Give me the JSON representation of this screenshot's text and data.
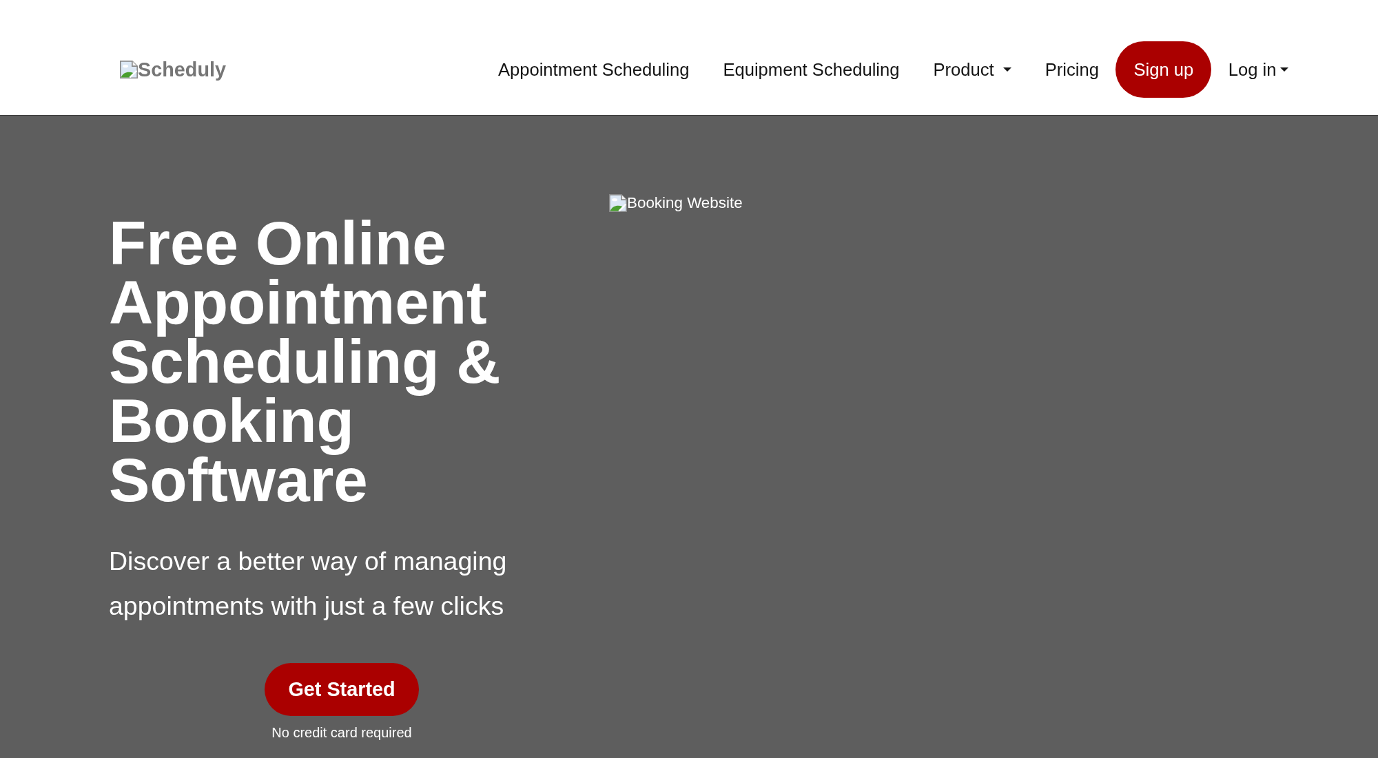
{
  "header": {
    "logo": {
      "alt_text": "Scheduly"
    },
    "nav": [
      {
        "label": "Appointment Scheduling",
        "kind": "link"
      },
      {
        "label": "Equipment Scheduling",
        "kind": "link"
      },
      {
        "label": "Product",
        "kind": "dropdown"
      },
      {
        "label": "Pricing",
        "kind": "link"
      },
      {
        "label": "Sign up",
        "kind": "button"
      },
      {
        "label": "Log in",
        "kind": "menu"
      }
    ]
  },
  "hero": {
    "heading": "Free Online Appointment Scheduling & Booking Software",
    "subheading": "Discover a better way of managing appointments with just a few clicks",
    "cta": {
      "label": "Get Started",
      "note": "No credit card required"
    },
    "image": {
      "alt_text": "Booking Website"
    }
  }
}
